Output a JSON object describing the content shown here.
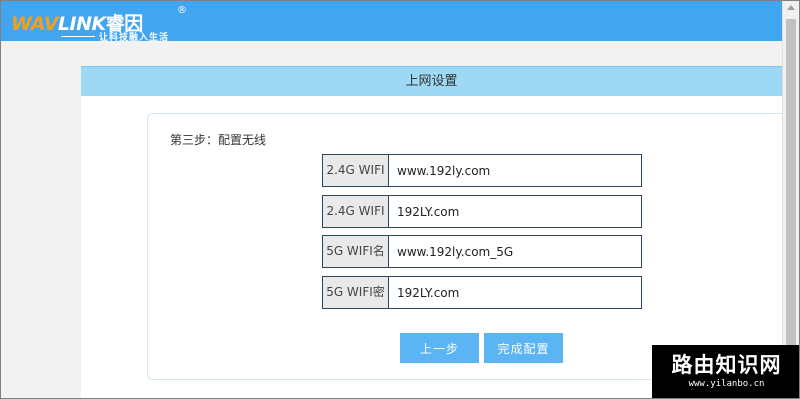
{
  "header": {
    "logo_wav": "WAV",
    "logo_link": "LINK",
    "logo_cn": "睿因",
    "logo_reg": "®",
    "slogan": "让科技融入生活"
  },
  "panel": {
    "title": "上网设置",
    "step_label": "第三步：配置无线",
    "fields": [
      {
        "label": "2.4G WIFI",
        "value": "www.192ly.com"
      },
      {
        "label": "2.4G WIFI",
        "value": "192LY.com"
      },
      {
        "label": "5G WIFI名",
        "value": "www.192ly.com_5G"
      },
      {
        "label": "5G WIFI密",
        "value": "192LY.com"
      }
    ],
    "buttons": {
      "prev": "上一步",
      "finish": "完成配置"
    }
  },
  "watermark": {
    "title": "路由知识网",
    "url": "www.yilanbo.cn"
  },
  "colors": {
    "header_bg": "#42a5f0",
    "title_bar_bg": "#9dd8f5",
    "button_bg": "#5bb5f2",
    "logo_accent": "#f0a020"
  }
}
